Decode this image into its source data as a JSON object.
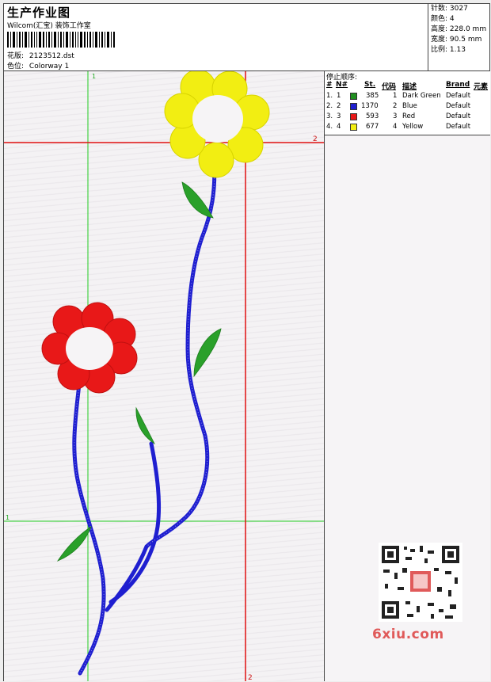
{
  "header": {
    "title": "生产作业图",
    "subtitle": "Wilcom(汇宝) 装饰工作室",
    "design_label": "花版:",
    "design_value": "2123512.dst",
    "colorway_label": "色位:",
    "colorway_value": "Colorway 1"
  },
  "stats": {
    "stitches_label": "针数:",
    "stitches": "3027",
    "colors_label": "颜色:",
    "colors": "4",
    "height_label": "高度:",
    "height": "228.0 mm",
    "width_label": "宽度:",
    "width": "90.5 mm",
    "scale_label": "比例:",
    "scale": "1.13"
  },
  "guides": {
    "green_vertical_label": "1",
    "green_horizontal_label": "1",
    "red_vertical_label": "2",
    "red_horizontal_label": "2"
  },
  "sequence": {
    "title": "停止顺序:",
    "headers": {
      "num": "#",
      "n": "N#",
      "st": "St.",
      "code": "代码",
      "desc": "描述",
      "brand": "Brand",
      "element": "元素"
    },
    "rows": [
      {
        "num": "1.",
        "n": "1",
        "color": "#1f8f1f",
        "st": "385",
        "code": "1",
        "desc": "Dark Green",
        "brand": "Default"
      },
      {
        "num": "2.",
        "n": "2",
        "color": "#1f1fd0",
        "st": "1370",
        "code": "2",
        "desc": "Blue",
        "brand": "Default"
      },
      {
        "num": "3.",
        "n": "3",
        "color": "#e81818",
        "st": "593",
        "code": "3",
        "desc": "Red",
        "brand": "Default"
      },
      {
        "num": "4.",
        "n": "4",
        "color": "#f2ee12",
        "st": "677",
        "code": "4",
        "desc": "Yellow",
        "brand": "Default"
      }
    ]
  },
  "watermark": {
    "text": "6xiu.com"
  }
}
